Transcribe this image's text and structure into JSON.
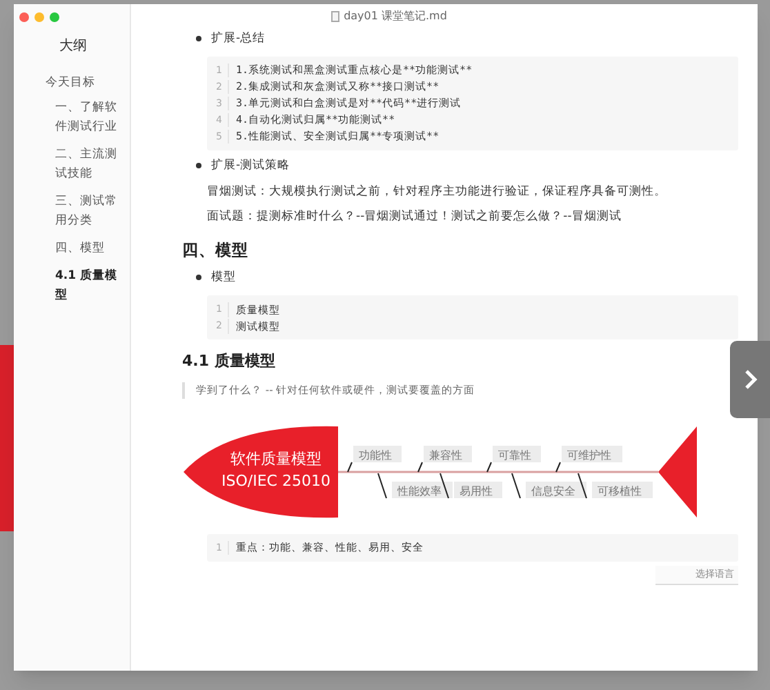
{
  "window": {
    "title": "day01 课堂笔记.md"
  },
  "sidebar": {
    "title": "大纲",
    "items": [
      {
        "label": "今天目标",
        "selected": false,
        "children": [
          {
            "label": "一、了解软件测试行业",
            "selected": false
          },
          {
            "label": "二、主流测试技能",
            "selected": false
          },
          {
            "label": "三、测试常用分类",
            "selected": false
          },
          {
            "label": "四、模型",
            "selected": false
          },
          {
            "label": "4.1 质量模型",
            "selected": true
          }
        ]
      }
    ]
  },
  "content": [
    {
      "kind": "bullet",
      "text": "扩展-总结"
    },
    {
      "kind": "code",
      "lines": [
        {
          "number": "1",
          "text": "1.系统测试和黑盒测试重点核心是**功能测试**"
        },
        {
          "number": "2",
          "text": "2.集成测试和灰盒测试又称**接口测试**"
        },
        {
          "number": "3",
          "text": "3.单元测试和白盒测试是对**代码**进行测试"
        },
        {
          "number": "4",
          "text": "4.自动化测试归属**功能测试**"
        },
        {
          "number": "5",
          "text": "5.性能测试、安全测试归属**专项测试**"
        }
      ]
    },
    {
      "kind": "bullet",
      "text": "扩展-测试策略"
    },
    {
      "kind": "paragraph",
      "text": "冒烟测试：大规模执行测试之前，针对程序主功能进行验证，保证程序具备可测性。"
    },
    {
      "kind": "paragraph",
      "text": "面试题：提测标准时什么？--冒烟测试通过！测试之前要怎么做？--冒烟测试"
    },
    {
      "kind": "heading2",
      "text": "四、模型"
    },
    {
      "kind": "bullet",
      "text": "模型"
    },
    {
      "kind": "code",
      "lines": [
        {
          "number": "1",
          "text": "质量模型"
        },
        {
          "number": "2",
          "text": "测试模型"
        }
      ]
    },
    {
      "kind": "heading3",
      "text": "4.1 质量模型"
    },
    {
      "kind": "quote",
      "text": "学到了什么？ -- 针对任何软件或硬件，测试要覆盖的方面"
    },
    {
      "kind": "fishbone",
      "head": [
        "软件质量模型",
        "ISO/IEC 25010"
      ],
      "top": [
        "功能性",
        "兼容性",
        "可靠性",
        "可维护性"
      ],
      "bottom": [
        "性能效率",
        "易用性",
        "信息安全",
        "可移植性"
      ]
    },
    {
      "kind": "code",
      "lines": [
        {
          "number": "1",
          "text": "重点：功能、兼容、性能、易用、安全"
        }
      ],
      "language_button": "选择语言"
    }
  ]
}
